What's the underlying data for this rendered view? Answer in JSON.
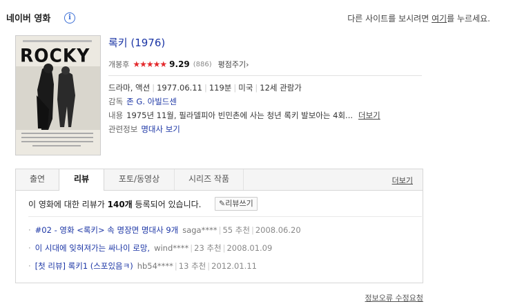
{
  "header": {
    "title": "네이버 영화",
    "info_icon": "i",
    "other_site_prefix": "다른 사이트를 보시려면 ",
    "other_site_link": "여기",
    "other_site_suffix": "를 누르세요."
  },
  "poster": {
    "title": "ROCKY"
  },
  "movie": {
    "title": "록키 (1976)",
    "release_label": "개봉후",
    "stars": "★★★★★",
    "score": "9.29",
    "votes": "(886)",
    "rate_link": "평점주기",
    "genre": "드라마, 액션",
    "date": "1977.06.11",
    "runtime": "119분",
    "country": "미국",
    "age": "12세 관람가",
    "director_label": "감독",
    "director": "존 G. 아빌드센",
    "plot_label": "내용",
    "plot": "1975년 11월, 필라델피아 빈민촌에 사는 청년 록키 발보아는 4회...",
    "plot_more": "더보기",
    "related_label": "관련정보",
    "related_link": "명대사 보기"
  },
  "tabs": {
    "items": [
      "출연",
      "리뷰",
      "포토/동영상",
      "시리즈 작품"
    ],
    "active_index": 1,
    "more": "더보기"
  },
  "reviews": {
    "count_prefix": "이 영화에 대한 리뷰가 ",
    "count": "140개",
    "count_suffix": " 등록되어 있습니다.",
    "write_label": "리뷰쓰기",
    "items": [
      {
        "title": "#02 - 영화 <록키> 속 명장면 명대사 9개",
        "writer": "saga****",
        "recommend": "55 추천",
        "date": "2008.06.20"
      },
      {
        "title": "이 시대에 잊혀져가는 싸나이 로망,",
        "writer": "wind****",
        "recommend": "23 추천",
        "date": "2008.01.09"
      },
      {
        "title": "[첫 리뷰] 록키1 (스포있음ㅋ)",
        "writer": "hb54****",
        "recommend": "13 추천",
        "date": "2012.01.11"
      }
    ]
  },
  "footer": {
    "report": "정보오류 수정요청"
  },
  "colors": {
    "link_blue": "#1b35a5",
    "star_red": "#e4292c"
  }
}
